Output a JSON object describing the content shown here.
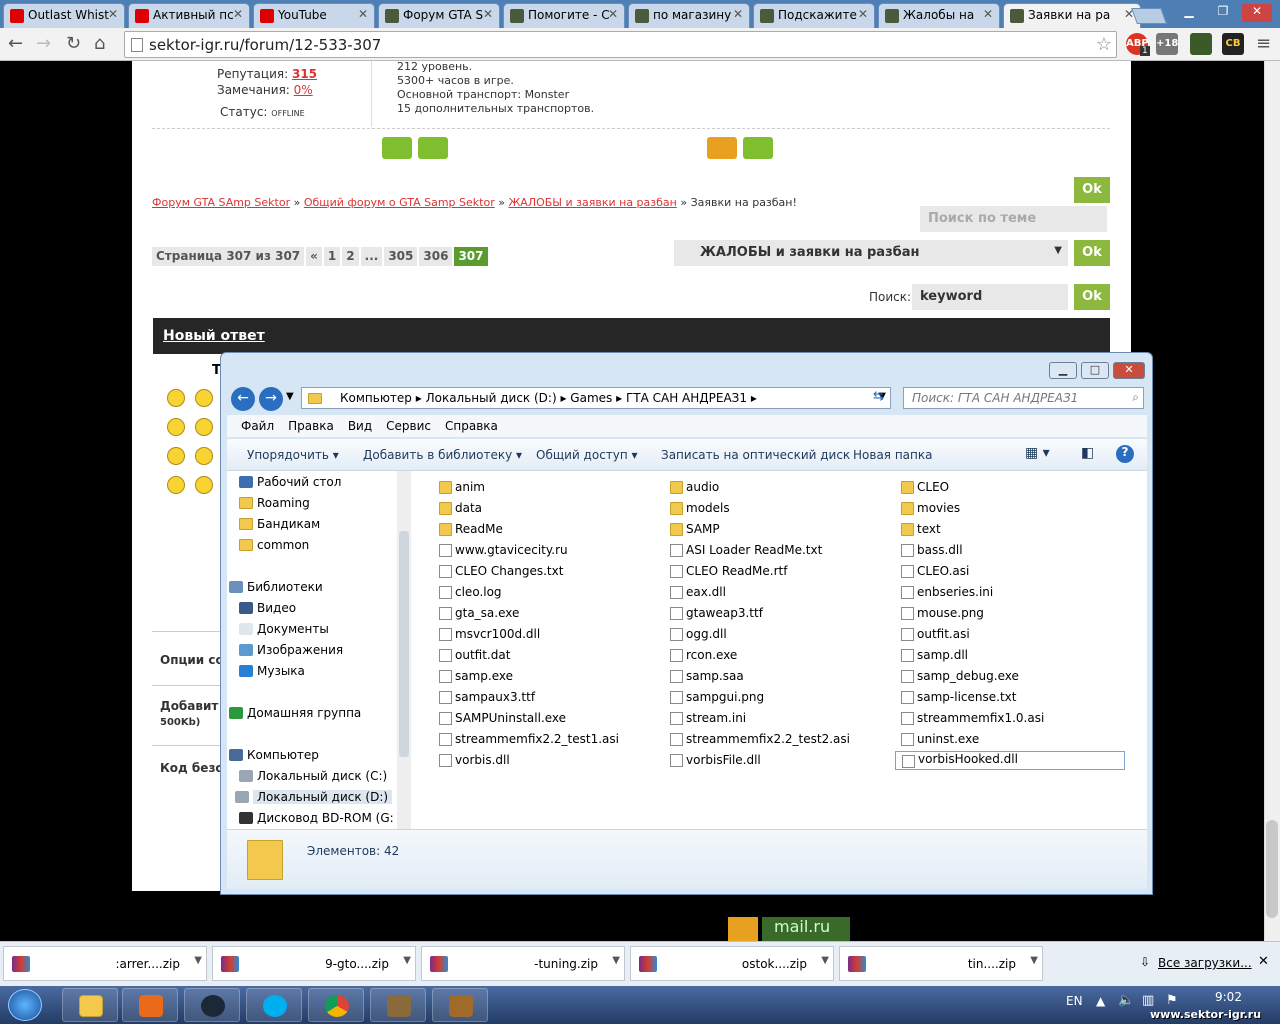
{
  "tabs": [
    {
      "label": "Outlast Whist",
      "icon": "youtube-icon",
      "active": false
    },
    {
      "label": "Активный пс",
      "icon": "youtube-icon",
      "active": false
    },
    {
      "label": "YouTube",
      "icon": "youtube-icon",
      "active": false
    },
    {
      "label": "Форум GTA S",
      "icon": "gta-icon",
      "active": false
    },
    {
      "label": "Помогите - С",
      "icon": "gta-icon",
      "active": false
    },
    {
      "label": "по магазину",
      "icon": "gta-icon",
      "active": false
    },
    {
      "label": "Подскажите",
      "icon": "gta-icon",
      "active": false
    },
    {
      "label": "Жалобы на",
      "icon": "gta-icon",
      "active": false
    },
    {
      "label": "Заявки на ра",
      "icon": "gta-icon",
      "active": true
    }
  ],
  "address": {
    "url": "sektor-igr.ru/forum/12-533-307"
  },
  "extensions": {
    "abp_label": "ABP",
    "abp_count": "1",
    "plus18": "+18",
    "cb": "CB"
  },
  "forum": {
    "rep_label": "Репутация:",
    "rep_value": "315",
    "warn_label": "Замечания:",
    "warn_value": "0%",
    "status_label": "Статус:",
    "status_value": "OFFLINE",
    "sig": [
      "212 уровень.",
      "5300+ часов в игре.",
      "Основной транспорт: Monster",
      "15 дополнительных транспортов."
    ],
    "breadcrumb": {
      "b1": "Форум GTA SAmp Sektor",
      "b2": "Общий форум о GTA Samp Sektor",
      "b3": "ЖАЛОБЫ и заявки на разбан",
      "b4": "Заявки на разбан!",
      "sep": "»"
    },
    "ok": "Ok",
    "topic_search_placeholder": "Поиск по теме",
    "pager": {
      "label": "Страница 307 из 307",
      "items": [
        "«",
        "1",
        "2",
        "...",
        "305",
        "306"
      ],
      "current": "307"
    },
    "jump_select": "ЖАЛОБЫ и заявки на разбан",
    "search_label": "Поиск:",
    "search_value": "keyword",
    "new_reply": "Новый ответ",
    "side_t": "Т",
    "opts": "Опции со",
    "add": "Добавит",
    "size_limit": "500Kb)",
    "code": "Код безо"
  },
  "explorer": {
    "path": [
      "Компьютер",
      "Локальный диск (D:)",
      "Games",
      "ГТА САН АНДРЕАЗ1"
    ],
    "search_placeholder": "Поиск: ГТА САН АНДРЕАЗ1",
    "menu": [
      "Файл",
      "Правка",
      "Вид",
      "Сервис",
      "Справка"
    ],
    "commands": [
      "Упорядочить ▾",
      "Добавить в библиотеку ▾",
      "Общий доступ ▾",
      "Записать на оптический диск",
      "Новая папка"
    ],
    "tree": [
      {
        "label": "Рабочий стол",
        "type": "desktop"
      },
      {
        "label": "Roaming",
        "type": "folder"
      },
      {
        "label": "Бандикам",
        "type": "folder"
      },
      {
        "label": "common",
        "type": "folder"
      },
      {
        "label": "Библиотеки",
        "type": "library"
      },
      {
        "label": "Видео",
        "type": "video"
      },
      {
        "label": "Документы",
        "type": "docs"
      },
      {
        "label": "Изображения",
        "type": "images"
      },
      {
        "label": "Музыка",
        "type": "music"
      },
      {
        "label": "Домашняя группа",
        "type": "homegroup"
      },
      {
        "label": "Компьютер",
        "type": "computer"
      },
      {
        "label": "Локальный диск (C:)",
        "type": "disk"
      },
      {
        "label": "Локальный диск (D:)",
        "type": "disk"
      },
      {
        "label": "Дисковод BD-ROM (G:",
        "type": "bd"
      }
    ],
    "files": [
      [
        "anim",
        "audio",
        "CLEO"
      ],
      [
        "data",
        "models",
        "movies"
      ],
      [
        "ReadMe",
        "SAMP",
        "text"
      ],
      [
        "www.gtavicecity.ru",
        "ASI Loader ReadMe.txt",
        "bass.dll"
      ],
      [
        "CLEO Changes.txt",
        "CLEO ReadMe.rtf",
        "CLEO.asi"
      ],
      [
        "cleo.log",
        "eax.dll",
        "enbseries.ini"
      ],
      [
        "gta_sa.exe",
        "gtaweap3.ttf",
        "mouse.png"
      ],
      [
        "msvcr100d.dll",
        "ogg.dll",
        "outfit.asi"
      ],
      [
        "outfit.dat",
        "rcon.exe",
        "samp.dll"
      ],
      [
        "samp.exe",
        "samp.saa",
        "samp_debug.exe"
      ],
      [
        "sampaux3.ttf",
        "sampgui.png",
        "samp-license.txt"
      ],
      [
        "SAMPUninstall.exe",
        "stream.ini",
        "streammemfix1.0.asi"
      ],
      [
        "streammemfix2.2_test1.asi",
        "streammemfix2.2_test2.asi",
        "uninst.exe"
      ],
      [
        "vorbis.dll",
        "vorbisFile.dll",
        "vorbisHooked.dll"
      ]
    ],
    "folder_rows": 3,
    "status": "Элементов: 42"
  },
  "downloads": {
    "items": [
      ":arrer....zip",
      "9-gto....zip",
      "-tuning.zip",
      "ostok....zip",
      "tin....zip"
    ],
    "all": "Все загрузки..."
  },
  "taskbar": {
    "lang": "EN",
    "time": "9:02",
    "watermark": "www.sektor-igr.ru"
  },
  "footer": {
    "mailru": "mail.ru"
  }
}
